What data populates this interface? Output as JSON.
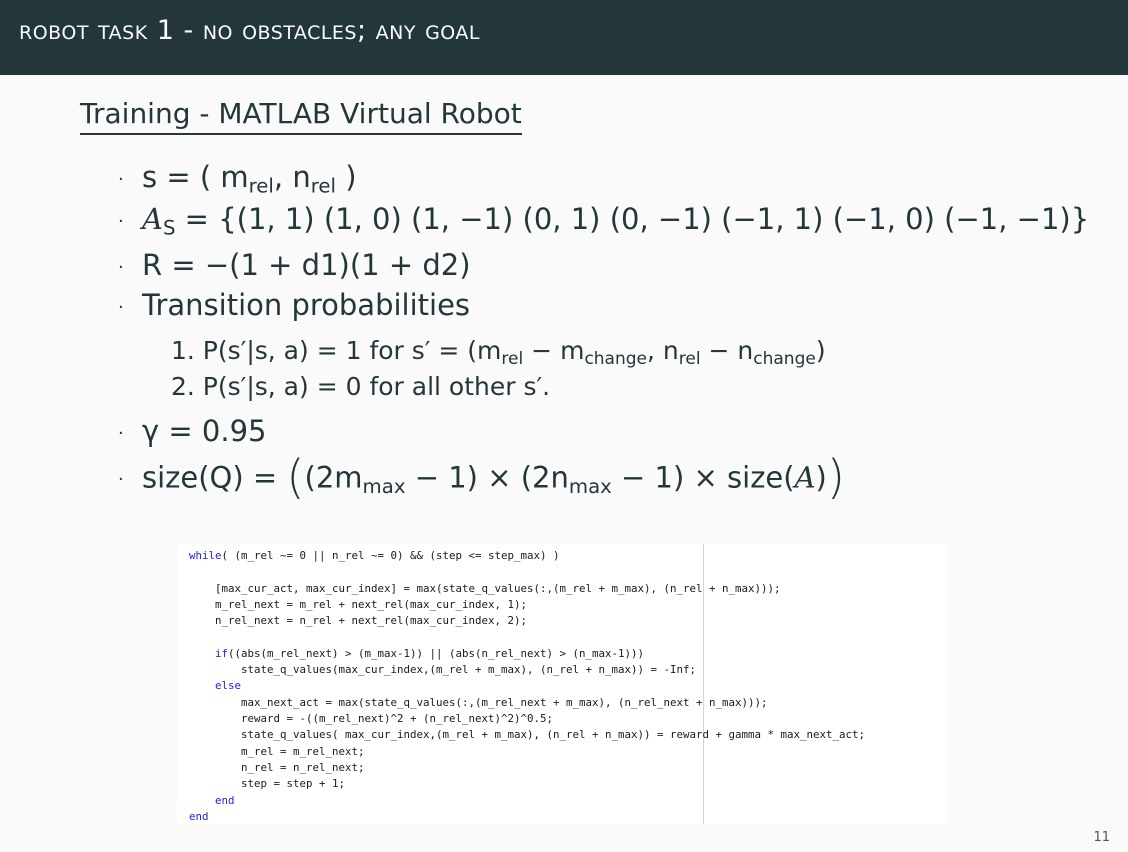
{
  "header": {
    "title": "ROBOT TASK 1 - NO OBSTACLES; ANY GOAL"
  },
  "subtitle": "Training - MATLAB Virtual Robot",
  "bullets": {
    "state": {
      "pre": "s = ( m",
      "sub1": "rel",
      "mid": ", n",
      "sub2": "rel",
      "post": " )"
    },
    "actions": {
      "cal": "A",
      "sub": "S",
      "set": " = {(1, 1) (1, 0) (1, −1) (0, 1) (0, −1) (−1, 1) (−1, 0) (−1, −1)}"
    },
    "reward": "R = −(1 + d1)(1 + d2)",
    "transition": {
      "label": "Transition probabilities",
      "item1": {
        "pre": "1.  P(s′|s, a) = 1   for  s′ = (m",
        "s1": "rel",
        "t1": " − m",
        "s2": "change",
        "t2": ", n",
        "s3": "rel",
        "t3": " − n",
        "s4": "change",
        "t4": ")"
      },
      "item2": "2.  P(s′|s, a) = 0   for all other s′."
    },
    "gamma": "γ = 0.95",
    "size": {
      "pre": "size(Q) = ",
      "a": "(2m",
      "s1": "max",
      "b": " − 1) × (2n",
      "s2": "max",
      "c": " − 1) × size(",
      "cal": "A",
      "d": ")"
    }
  },
  "code": {
    "lines": [
      {
        "kw": "while",
        "text": "( (m_rel ~= 0 || n_rel ~= 0) && (step <= step_max) )"
      },
      {
        "kw": "",
        "text": ""
      },
      {
        "kw": "",
        "text": "    [max_cur_act, max_cur_index] = max(state_q_values(:,(m_rel + m_max), (n_rel + n_max)));"
      },
      {
        "kw": "",
        "text": "    m_rel_next = m_rel + next_rel(max_cur_index, 1);"
      },
      {
        "kw": "",
        "text": "    n_rel_next = n_rel + next_rel(max_cur_index, 2);"
      },
      {
        "kw": "",
        "text": ""
      },
      {
        "kw": "    if",
        "text": "((abs(m_rel_next) > (m_max-1)) || (abs(n_rel_next) > (n_max-1)))"
      },
      {
        "kw": "",
        "text": "        state_q_values(max_cur_index,(m_rel + m_max), (n_rel + n_max)) = -Inf;"
      },
      {
        "kw": "    else",
        "text": ""
      },
      {
        "kw": "",
        "text": "        max_next_act = max(state_q_values(:,(m_rel_next + m_max), (n_rel_next + n_max)));"
      },
      {
        "kw": "",
        "text": "        reward = -((m_rel_next)^2 + (n_rel_next)^2)^0.5;"
      },
      {
        "kw": "",
        "text": "        state_q_values( max_cur_index,(m_rel + m_max), (n_rel + n_max)) = reward + gamma * max_next_act;"
      },
      {
        "kw": "",
        "text": "        m_rel = m_rel_next;"
      },
      {
        "kw": "",
        "text": "        n_rel = n_rel_next;"
      },
      {
        "kw": "",
        "text": "        step = step + 1;"
      },
      {
        "kw": "    end",
        "text": ""
      },
      {
        "kw": "end",
        "text": ""
      }
    ]
  },
  "page_number": "11"
}
